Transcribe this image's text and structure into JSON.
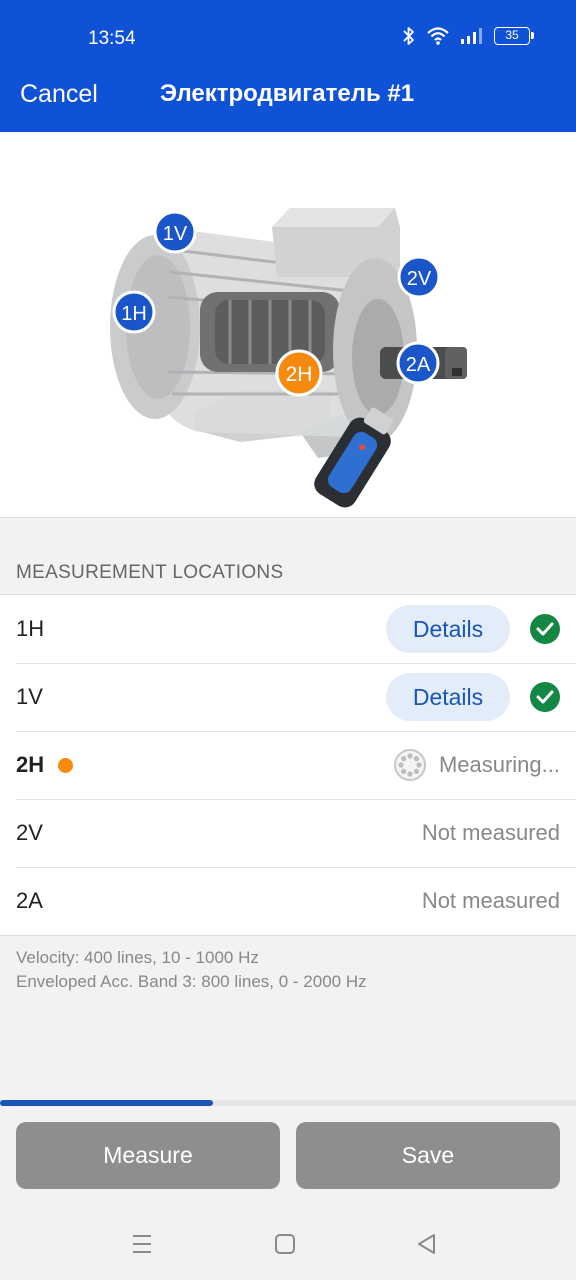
{
  "status_bar": {
    "time": "13:54",
    "battery": "35",
    "icons": [
      "bluetooth-icon",
      "wifi-icon",
      "signal-icon",
      "battery-icon"
    ]
  },
  "nav": {
    "cancel_label": "Cancel",
    "title": "Электродвигатель #1"
  },
  "illustration": {
    "markers": [
      "1V",
      "1H",
      "2V",
      "2A",
      "2H"
    ],
    "active_marker": "2H"
  },
  "measurement_locations": {
    "section_title": "MEASUREMENT LOCATIONS",
    "rows": [
      {
        "label": "1H",
        "action": "Details",
        "status": "done"
      },
      {
        "label": "1V",
        "action": "Details",
        "status": "done"
      },
      {
        "label": "2H",
        "status_text": "Measuring...",
        "status": "measuring"
      },
      {
        "label": "2V",
        "status_text": "Not measured",
        "status": "not-measured"
      },
      {
        "label": "2A",
        "status_text": "Not measured",
        "status": "not-measured"
      }
    ]
  },
  "footnote": {
    "line1": "Velocity: 400 lines, 10 - 1000 Hz",
    "line2": "Enveloped Acc. Band 3: 800 lines, 0 - 2000 Hz"
  },
  "progress": {
    "fraction": 0.37
  },
  "actions": {
    "measure_label": "Measure",
    "save_label": "Save"
  },
  "colors": {
    "header": "#0f52d6",
    "marker_blue": "#1a55c9",
    "marker_active": "#f58a0f",
    "check_green": "#158744",
    "button_gray": "#8e8e91"
  }
}
